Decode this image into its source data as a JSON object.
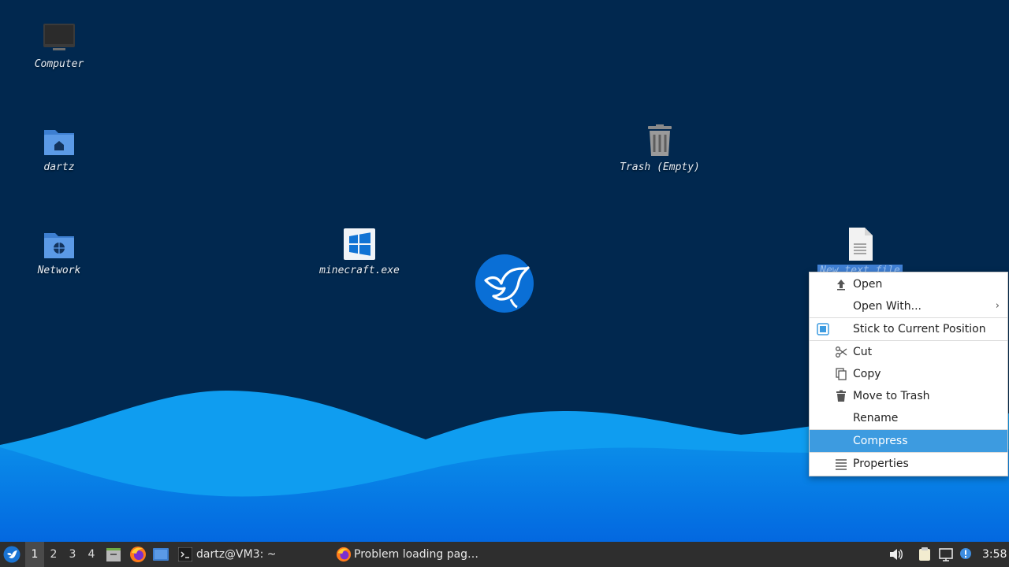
{
  "desktop": {
    "icons": [
      {
        "label": "Computer",
        "icon": "computer-icon"
      },
      {
        "label": "dartz",
        "icon": "home-folder-icon"
      },
      {
        "label": "Network",
        "icon": "network-folder-icon"
      },
      {
        "label": "minecraft.exe",
        "icon": "windows-executable-icon"
      },
      {
        "label": "Trash (Empty)",
        "icon": "trash-icon"
      },
      {
        "label": "New text file",
        "icon": "text-file-icon",
        "selected": true
      }
    ]
  },
  "context_menu": {
    "items": [
      {
        "label": "Open",
        "icon": "open-arrow-icon"
      },
      {
        "label": "Open With...",
        "submenu": true
      },
      {
        "label": "Stick to Current Position",
        "checked": true
      },
      {
        "label": "Cut",
        "icon": "scissors-icon"
      },
      {
        "label": "Copy",
        "icon": "copy-icon"
      },
      {
        "label": "Move to Trash",
        "icon": "trash-icon"
      },
      {
        "label": "Rename"
      },
      {
        "label": "Compress",
        "highlighted": true
      },
      {
        "label": "Properties",
        "icon": "properties-lines-icon"
      }
    ]
  },
  "taskbar": {
    "workspaces": [
      "1",
      "2",
      "3",
      "4"
    ],
    "active_workspace": "1",
    "tasks": [
      {
        "label": "dartz@VM3: ~",
        "icon": "terminal-icon"
      },
      {
        "label": "Problem loading pag…",
        "icon": "firefox-icon"
      }
    ],
    "clock": "3:58"
  },
  "colors": {
    "desktop_bg": "#01284f",
    "wave_light": "#0f9df0",
    "wave_dark": "#0479e8",
    "menu_highlight": "#3d9be0",
    "selection": "#3f7fd3",
    "taskbar_bg": "#2e2e2e"
  }
}
